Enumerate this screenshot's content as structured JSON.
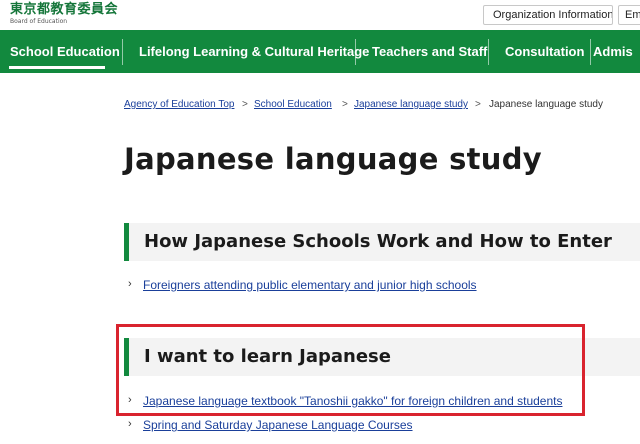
{
  "header": {
    "logo_jp": "東京都教育委員会",
    "logo_en": "Board of Education",
    "buttons": [
      "Organization Information",
      "Em"
    ]
  },
  "nav": {
    "items": [
      "School Education",
      "Lifelong Learning & Cultural Heritage",
      "Teachers and Staff",
      "Consultation",
      "Admis"
    ],
    "active": "School Education"
  },
  "breadcrumb": {
    "links": [
      "Agency of Education Top",
      "School Education",
      "Japanese language study"
    ],
    "current": "Japanese language study",
    "separator": ">"
  },
  "page": {
    "title": "Japanese language study"
  },
  "sections": [
    {
      "heading": "How Japanese Schools Work and How to Enter",
      "links": [
        "Foreigners attending public elementary and junior high schools"
      ]
    },
    {
      "heading": "I want to learn Japanese",
      "links": [
        "Japanese language textbook \"Tanoshii gakko\" for foreign children and students",
        "Spring and Saturday Japanese Language Courses"
      ]
    }
  ],
  "colors": {
    "brand_green": "#12893e",
    "link_blue": "#1a3f9a",
    "highlight_red": "#d9232e"
  }
}
